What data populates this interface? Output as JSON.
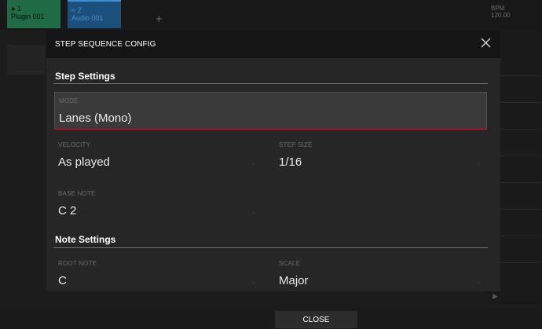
{
  "background": {
    "tracks": [
      {
        "number": "1",
        "name": "Plugin 001"
      },
      {
        "number": "2",
        "name": "Audio 001"
      }
    ],
    "add_track_label": "+",
    "bpm_label": "BPM",
    "bpm_value": "120.00"
  },
  "dialog": {
    "title": "STEP SEQUENCE CONFIG",
    "close_icon": "close-icon",
    "sections": {
      "step_settings": {
        "title": "Step Settings",
        "mode": {
          "label": "MODE",
          "value": "Lanes (Mono)"
        },
        "velocity": {
          "label": "VELOCITY",
          "value": "As played"
        },
        "step_size": {
          "label": "STEP SIZE",
          "value": "1/16"
        },
        "base_note": {
          "label": "BASE NOTE",
          "value": "C 2"
        }
      },
      "note_settings": {
        "title": "Note Settings",
        "root_note": {
          "label": "ROOT NOTE",
          "value": "C"
        },
        "scale": {
          "label": "SCALE",
          "value": "Major"
        }
      }
    }
  },
  "footer": {
    "close_label": "CLOSE"
  },
  "colors": {
    "accent_border": "#a5283a",
    "track1": "#1f6b45",
    "track2": "#1b4f7c"
  }
}
